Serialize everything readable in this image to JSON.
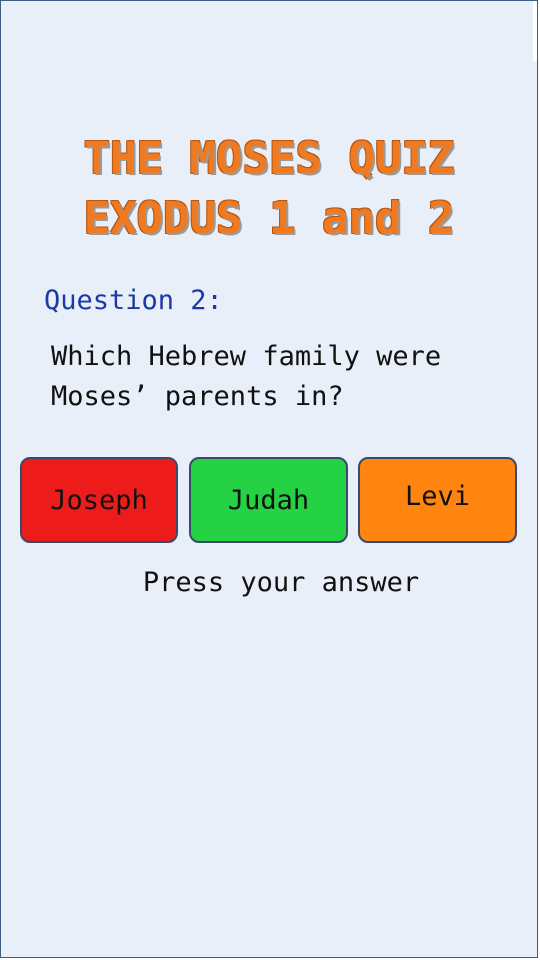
{
  "title": {
    "line1": "THE MOSES QUIZ",
    "line2": "EXODUS 1 and 2"
  },
  "question": {
    "label": "Question 2:",
    "text": "Which Hebrew family were Moses’ parents in?"
  },
  "answers": [
    {
      "label": "Joseph",
      "color": "#ee1b1b"
    },
    {
      "label": "Judah",
      "color": "#25d244"
    },
    {
      "label": "Levi",
      "color": "#ff8410"
    }
  ],
  "prompt": "Press your answer",
  "colors": {
    "background": "#e9eff8",
    "title": "#f07a22",
    "question_label": "#1a3aa8",
    "border": "#3a5f86"
  }
}
